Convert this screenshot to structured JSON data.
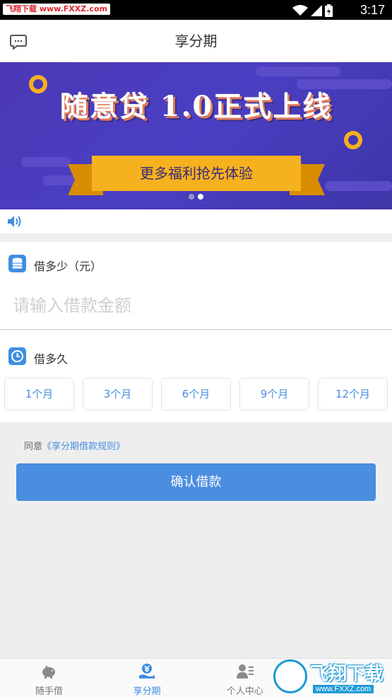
{
  "status_bar": {
    "watermark": "飞翔下载 www.FXXZ.com",
    "time": "3:17"
  },
  "header": {
    "title": "享分期",
    "message_icon": "message-icon"
  },
  "banner": {
    "headline": "随意贷 1.0正式上线",
    "ribbon": "更多福利抢先体验",
    "slides": 2,
    "active_slide": 2,
    "colors": {
      "bg": "#4b38b6",
      "gold": "#f6b11e"
    }
  },
  "notice": {
    "icon": "speaker-icon"
  },
  "amount_section": {
    "label": "借多少（元）",
    "icon": "coins-icon",
    "input_placeholder": "请输入借款金额",
    "input_value": ""
  },
  "term_section": {
    "label": "借多久",
    "icon": "clock-icon",
    "options": [
      "1个月",
      "3个月",
      "6个月",
      "9个月",
      "12个月"
    ]
  },
  "agreement": {
    "prefix": "同意",
    "link": "《享分期借款规则》"
  },
  "confirm_button": "确认借款",
  "tabbar": {
    "items": [
      {
        "label": "随手借",
        "icon": "piggy-bank-icon",
        "active": false
      },
      {
        "label": "享分期",
        "icon": "yen-hand-icon",
        "active": true
      },
      {
        "label": "个人中心",
        "icon": "user-card-icon",
        "active": false
      }
    ]
  },
  "watermark_logo": {
    "title": "飞翔下载",
    "url": "www.FXXZ.com"
  },
  "colors": {
    "accent": "#4a8ee0",
    "page_bg": "#eeeeee"
  }
}
